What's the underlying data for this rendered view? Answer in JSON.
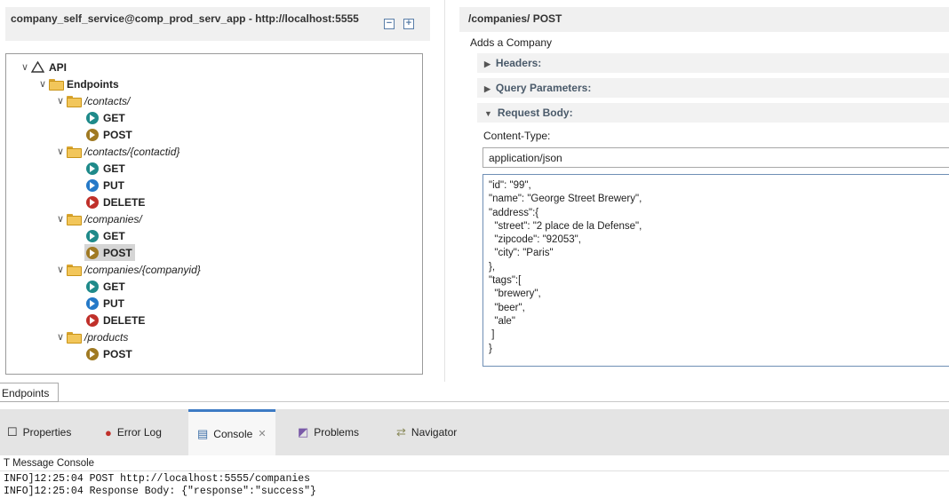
{
  "left": {
    "title": "company_self_service@comp_prod_serv_app - http://localhost:5555",
    "tree": {
      "root": "API",
      "endpoints": "Endpoints",
      "groups": [
        {
          "path": "/contacts/",
          "methods": [
            "GET",
            "POST"
          ]
        },
        {
          "path": "/contacts/{contactid}",
          "methods": [
            "GET",
            "PUT",
            "DELETE"
          ]
        },
        {
          "path": "/companies/",
          "methods": [
            "GET",
            "POST"
          ]
        },
        {
          "path": "/companies/{companyid}",
          "methods": [
            "GET",
            "PUT",
            "DELETE"
          ]
        },
        {
          "path": "/products",
          "methods": [
            "POST"
          ]
        }
      ]
    },
    "selected": "/companies/ POST",
    "bottom_tab": "Endpoints"
  },
  "right": {
    "title": "/companies/ POST",
    "subtitle": "Adds a Company",
    "sections": {
      "headers": "Headers:",
      "query": "Query Parameters:",
      "body": "Request Body:"
    },
    "content_type_label": "Content-Type:",
    "content_type_value": "application/json",
    "body_lines": [
      "\"id\": \"99\",",
      "\"name\": \"George Street Brewery\",",
      "\"address\":{",
      "  \"street\": \"2 place de la Defense\",",
      "  \"zipcode\": \"92053\",",
      "  \"city\": \"Paris\"",
      "},",
      "\"tags\":[",
      "  \"brewery\",",
      "  \"beer\",",
      "  \"ale\"",
      " ]",
      "}"
    ]
  },
  "views": {
    "tabs": {
      "properties": "Properties",
      "error_log": "Error Log",
      "console": "Console",
      "problems": "Problems",
      "navigator": "Navigator"
    },
    "active": "Console",
    "console_title": "T Message Console",
    "log_lines": [
      "INFO]12:25:04 POST http://localhost:5555/companies",
      "INFO]12:25:04 Response Body: {\"response\":\"success\"}"
    ]
  },
  "colors": {
    "get": "#1f8a8a",
    "post": "#a07a23",
    "put": "#2579c8",
    "delete": "#c0302a",
    "active_tab_accent": "#3d7bc4"
  }
}
